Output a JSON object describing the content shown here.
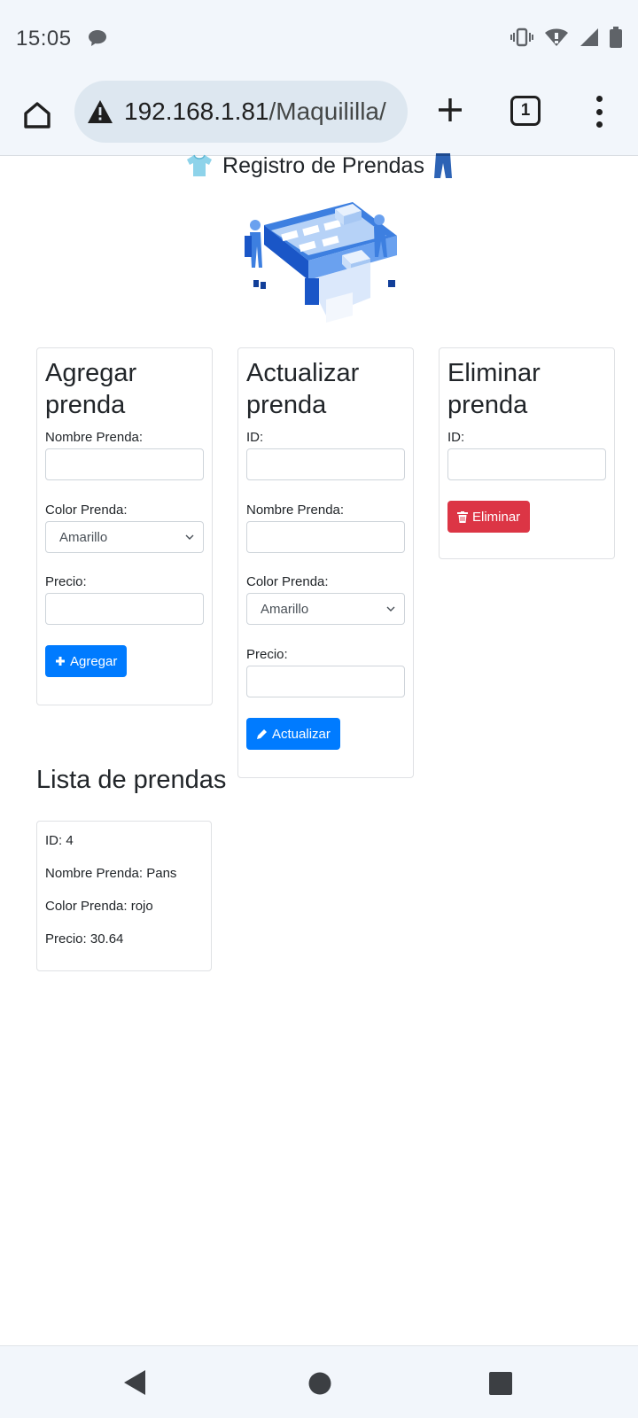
{
  "status": {
    "time": "15:05"
  },
  "browser": {
    "url_host": "192.168.1.81",
    "url_path": "/Maquililla/",
    "tab_count": "1"
  },
  "page": {
    "title": "Registro de Prendas"
  },
  "add_form": {
    "heading_line1": "Agregar",
    "heading_line2": "prenda",
    "name_label": "Nombre Prenda:",
    "color_label": "Color Prenda:",
    "color_value": "Amarillo",
    "price_label": "Precio:",
    "button_label": "Agregar",
    "button_icon": "plus-icon"
  },
  "update_form": {
    "heading_line1": "Actualizar",
    "heading_line2": "prenda",
    "id_label": "ID:",
    "name_label": "Nombre Prenda:",
    "color_label": "Color Prenda:",
    "color_value": "Amarillo",
    "price_label": "Precio:",
    "button_label": "Actualizar",
    "button_icon": "pencil-icon"
  },
  "delete_form": {
    "heading_line1": "Eliminar",
    "heading_line2": "prenda",
    "id_label": "ID:",
    "button_label": "Eliminar",
    "button_icon": "trash-icon"
  },
  "list": {
    "title": "Lista de prendas",
    "items": [
      {
        "id": "ID: 4",
        "name": "Nombre Prenda: Pans",
        "color": "Color Prenda: rojo",
        "price": "Precio: 30.64"
      }
    ]
  },
  "colors": {
    "primary": "#007bff",
    "danger": "#dc3545",
    "chrome_bg": "#f2f6fb",
    "url_bg": "#dde7f0"
  }
}
